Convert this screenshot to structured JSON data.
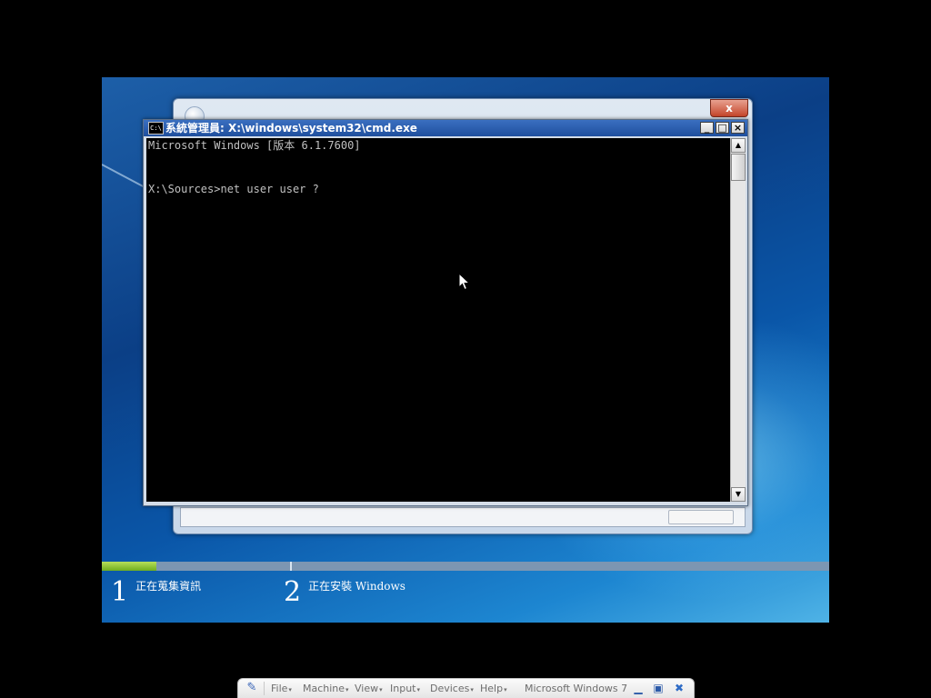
{
  "setup_window": {
    "close_label": "x"
  },
  "cmd": {
    "title": "系統管理員: X:\\windows\\system32\\cmd.exe",
    "icon_label": "C:\\",
    "minimize_label": "_",
    "maximize_label": "□",
    "close_label": "×",
    "lines": [
      "Microsoft Windows [版本 6.1.7600]",
      "",
      "",
      "X:\\Sources>net user user ?"
    ]
  },
  "steps": [
    {
      "number": "1",
      "label": "正在蒐集資訊"
    },
    {
      "number": "2",
      "label": "正在安裝 Windows"
    }
  ],
  "progress": {
    "fraction": 0.075,
    "accent_color": "#8cc63f"
  },
  "vbox_toolbar": {
    "menus": [
      "File",
      "Machine",
      "View",
      "Input",
      "Devices",
      "Help"
    ],
    "vm_name": "Microsoft Windows 7"
  },
  "icons": {
    "pin": "pin-icon",
    "minimize": "minimize-icon",
    "restore": "restore-icon",
    "close": "close-icon"
  }
}
